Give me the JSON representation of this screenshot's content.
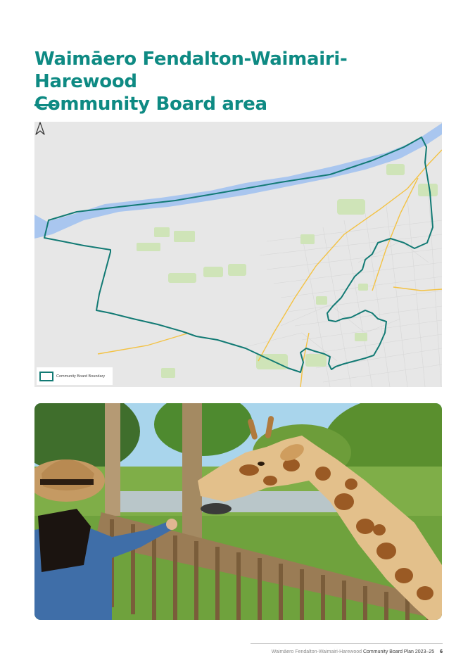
{
  "page": {
    "title_line1": "Waimāero Fendalton-Waimairi-Harewood",
    "title_line2": "Community Board area",
    "accent_color": "#0e8a83"
  },
  "map": {
    "legend_label": "Community Board Boundary",
    "north_icon": "north-arrow-icon",
    "boundary_color": "#127a74",
    "river_color": "#a9c6ef",
    "road_color": "#f3c244",
    "park_color": "#cfe4b8"
  },
  "photo": {
    "subject": "giraffe-feeding-photo"
  },
  "footer": {
    "doc_name": "Waimāero Fendalton-Waimairi-Harewood",
    "doc_type": "Community Board Plan 2023–25",
    "page_number": "6"
  }
}
